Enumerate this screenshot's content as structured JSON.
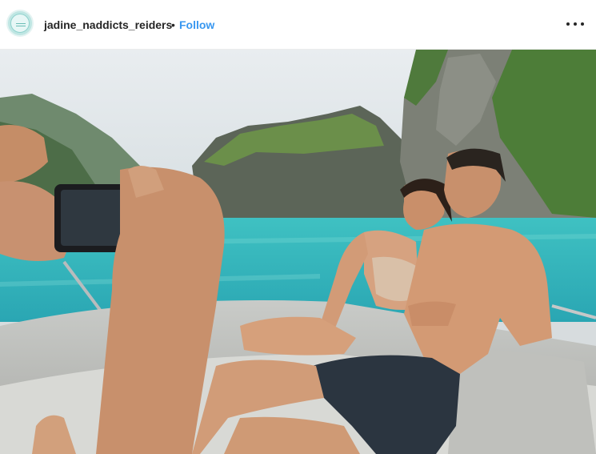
{
  "header": {
    "username": "jadine_naddicts_reiders",
    "separator": "•",
    "follow_label": "Follow"
  },
  "icons": {
    "avatar": "profile-avatar-logo",
    "more": "more-options-icon"
  },
  "colors": {
    "follow": "#3897f0",
    "text": "#262626",
    "water": "#37b8bd"
  }
}
